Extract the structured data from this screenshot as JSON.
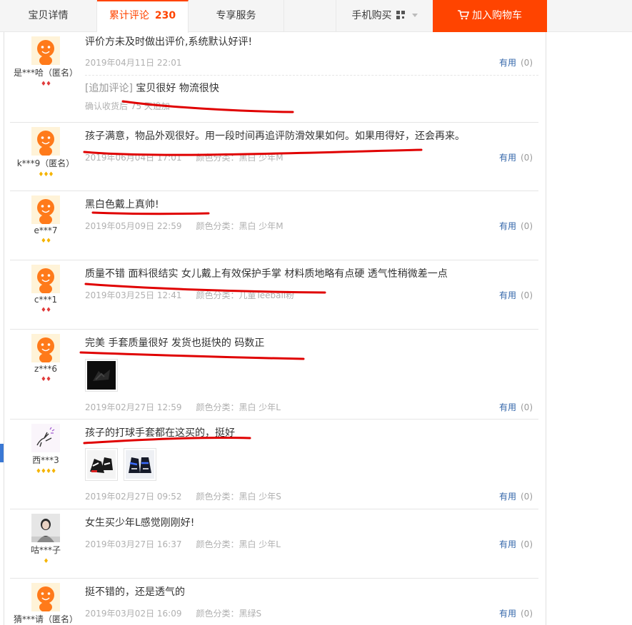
{
  "tabs": {
    "details": "宝贝详情",
    "reviews_label": "累计评论",
    "reviews_count": "230",
    "service": "专享服务",
    "mobile_buy": "手机购买",
    "add_to_cart": "加入购物车"
  },
  "colors": {
    "accent": "#ff4400",
    "link": "#3366aa",
    "annotation": "#e00000"
  },
  "useful_label": "有用",
  "reviews": [
    {
      "nick": "是***哈（匿名）",
      "rank": "♦♦",
      "text": "评价方未及时做出评价,系统默认好评!",
      "date": "2019年04月11日 22:01",
      "sku": "",
      "useful": "(0)",
      "append_tag": "[追加评论]",
      "append_text": "宝贝很好 物流很快",
      "append_time": "确认收货后 75 天追加"
    },
    {
      "nick": "k***9（匿名）",
      "rank": "♦♦♦",
      "text": "孩子满意，物品外观很好。用一段时间再追评防滑效果如何。如果用得好，还会再来。",
      "date": "2019年06月04日 17:01",
      "sku": "颜色分类：黑白 少年M",
      "useful": "(0)"
    },
    {
      "nick": "e***7",
      "rank": "♦♦",
      "text": "黑白色戴上真帅!",
      "date": "2019年05月09日 22:59",
      "sku": "颜色分类：黑白 少年M",
      "useful": "(0)"
    },
    {
      "nick": "c***1",
      "rank": "♦♦",
      "text": "质量不错 面料很结实 女儿戴上有效保护手掌 材料质地略有点硬 透气性稍微差一点",
      "date": "2019年03月25日 12:41",
      "sku": "颜色分类：儿童Teeball粉",
      "useful": "(0)"
    },
    {
      "nick": "z***6",
      "rank": "♦♦",
      "text": "完美 手套质量很好 发货也挺快的 码数正",
      "date": "2019年02月27日 12:59",
      "sku": "颜色分类：黑白 少年L",
      "useful": "(0)"
    },
    {
      "nick": "西***3",
      "rank": "♦♦♦♦",
      "text": "孩子的打球手套都在这买的，挺好",
      "date": "2019年02月27日 09:52",
      "sku": "颜色分类：黑白 少年S",
      "useful": "(0)"
    },
    {
      "nick": "咕***子",
      "rank": "♦",
      "text": "女生买少年L感觉刚刚好!",
      "date": "2019年03月27日 16:37",
      "sku": "颜色分类：黑白 少年L",
      "useful": "(0)"
    },
    {
      "nick": "猜***请（匿名）",
      "rank": "",
      "text": "挺不错的，还是透气的",
      "date": "2019年03月02日 16:09",
      "sku": "颜色分类：黑绿S",
      "useful": "(0)"
    }
  ]
}
